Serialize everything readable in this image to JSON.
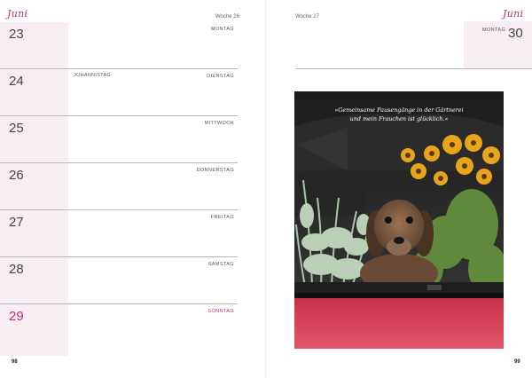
{
  "header": {
    "month_left": "Juni",
    "month_right": "Juni",
    "week_left": "Woche 26",
    "week_right": "Woche 27"
  },
  "days_left": [
    {
      "num": "23",
      "name": "MONTAG",
      "note": ""
    },
    {
      "num": "24",
      "name": "DIENSTAG",
      "note": "JOHANNISTAG"
    },
    {
      "num": "25",
      "name": "MITTWOCH",
      "note": ""
    },
    {
      "num": "26",
      "name": "DONNERSTAG",
      "note": ""
    },
    {
      "num": "27",
      "name": "FREITAG",
      "note": ""
    },
    {
      "num": "28",
      "name": "SAMSTAG",
      "note": ""
    },
    {
      "num": "29",
      "name": "SONNTAG",
      "note": ""
    }
  ],
  "day_right": {
    "num": "30",
    "name": "MONTAG"
  },
  "photo": {
    "quote_line1": "»Gemeinsame Pausengänge in der Gärtnerei",
    "quote_line2": "und mein Frauchen ist glücklich.«"
  },
  "page_numbers": {
    "left": "98",
    "right": "99"
  },
  "colors": {
    "accent": "#c2297a",
    "day_cell": "#f7eef4",
    "rule": "#b8b8b8"
  }
}
